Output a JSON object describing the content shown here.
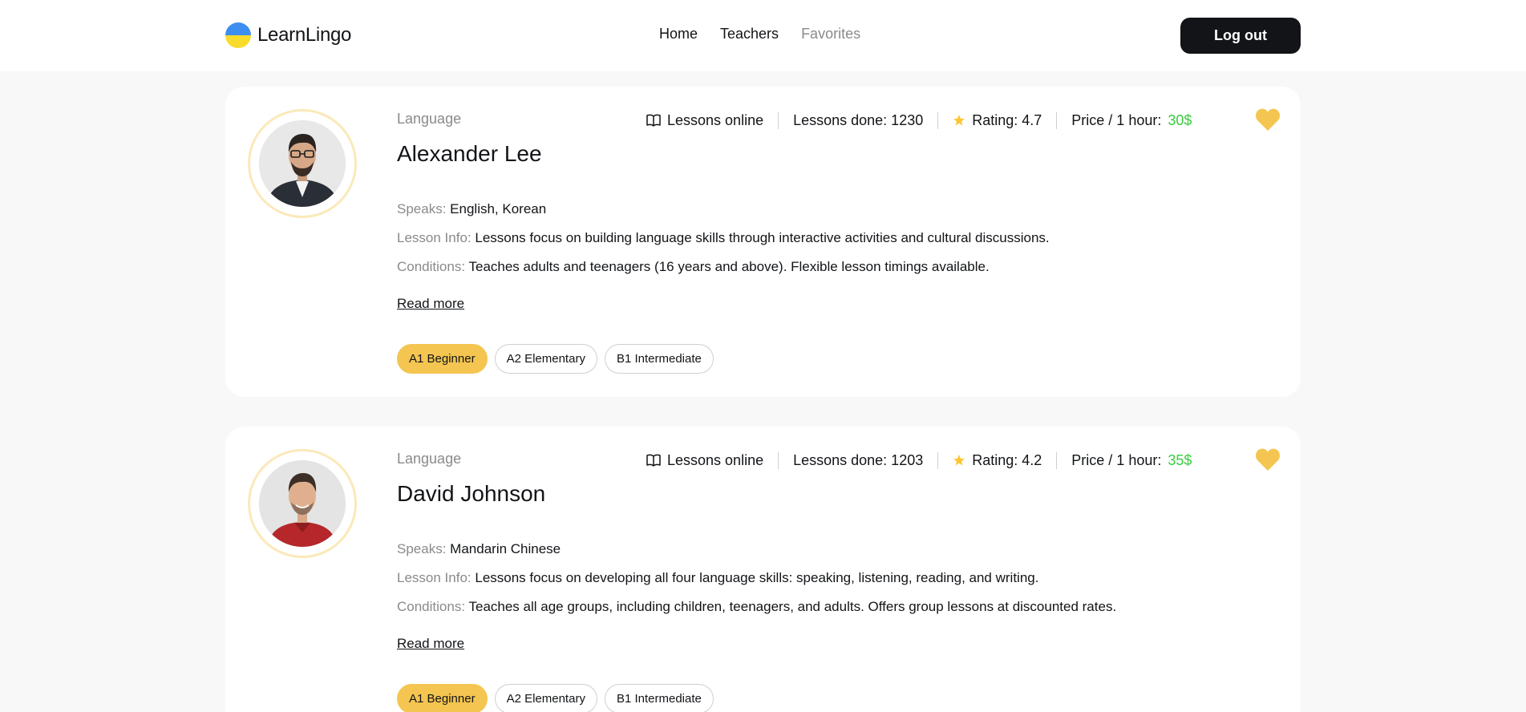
{
  "header": {
    "brand": "LearnLingo",
    "nav": [
      {
        "label": "Home"
      },
      {
        "label": "Teachers"
      },
      {
        "label": "Favorites"
      }
    ],
    "logout_label": "Log out"
  },
  "colors": {
    "accent": "#f4c550",
    "price": "#38cd3e",
    "muted": "#8a8a89",
    "dark": "#121417"
  },
  "cards": [
    {
      "language_label": "Language",
      "name": "Alexander Lee",
      "stats": {
        "online": "Lessons online",
        "lessons_done": "Lessons done: 1230",
        "rating": "Rating: 4.7",
        "price_label": "Price / 1 hour:",
        "price_value": "30$"
      },
      "favorite": true,
      "speaks_label": "Speaks:",
      "speaks": "English, Korean",
      "lesson_info_label": "Lesson Info:",
      "lesson_info": "Lessons focus on building language skills through interactive activities and cultural discussions.",
      "conditions_label": "Conditions:",
      "conditions": "Teaches adults and teenagers (16 years and above). Flexible lesson timings available.",
      "read_more": "Read more",
      "levels": [
        "A1 Beginner",
        "A2 Elementary",
        "B1 Intermediate"
      ]
    },
    {
      "language_label": "Language",
      "name": "David Johnson",
      "stats": {
        "online": "Lessons online",
        "lessons_done": "Lessons done: 1203",
        "rating": "Rating: 4.2",
        "price_label": "Price / 1 hour:",
        "price_value": "35$"
      },
      "favorite": true,
      "speaks_label": "Speaks:",
      "speaks": "Mandarin Chinese",
      "lesson_info_label": "Lesson Info:",
      "lesson_info": "Lessons focus on developing all four language skills: speaking, listening, reading, and writing.",
      "conditions_label": "Conditions:",
      "conditions": "Teaches all age groups, including children, teenagers, and adults. Offers group lessons at discounted rates.",
      "read_more": "Read more",
      "levels": [
        "A1 Beginner",
        "A2 Elementary",
        "B1 Intermediate"
      ]
    }
  ]
}
